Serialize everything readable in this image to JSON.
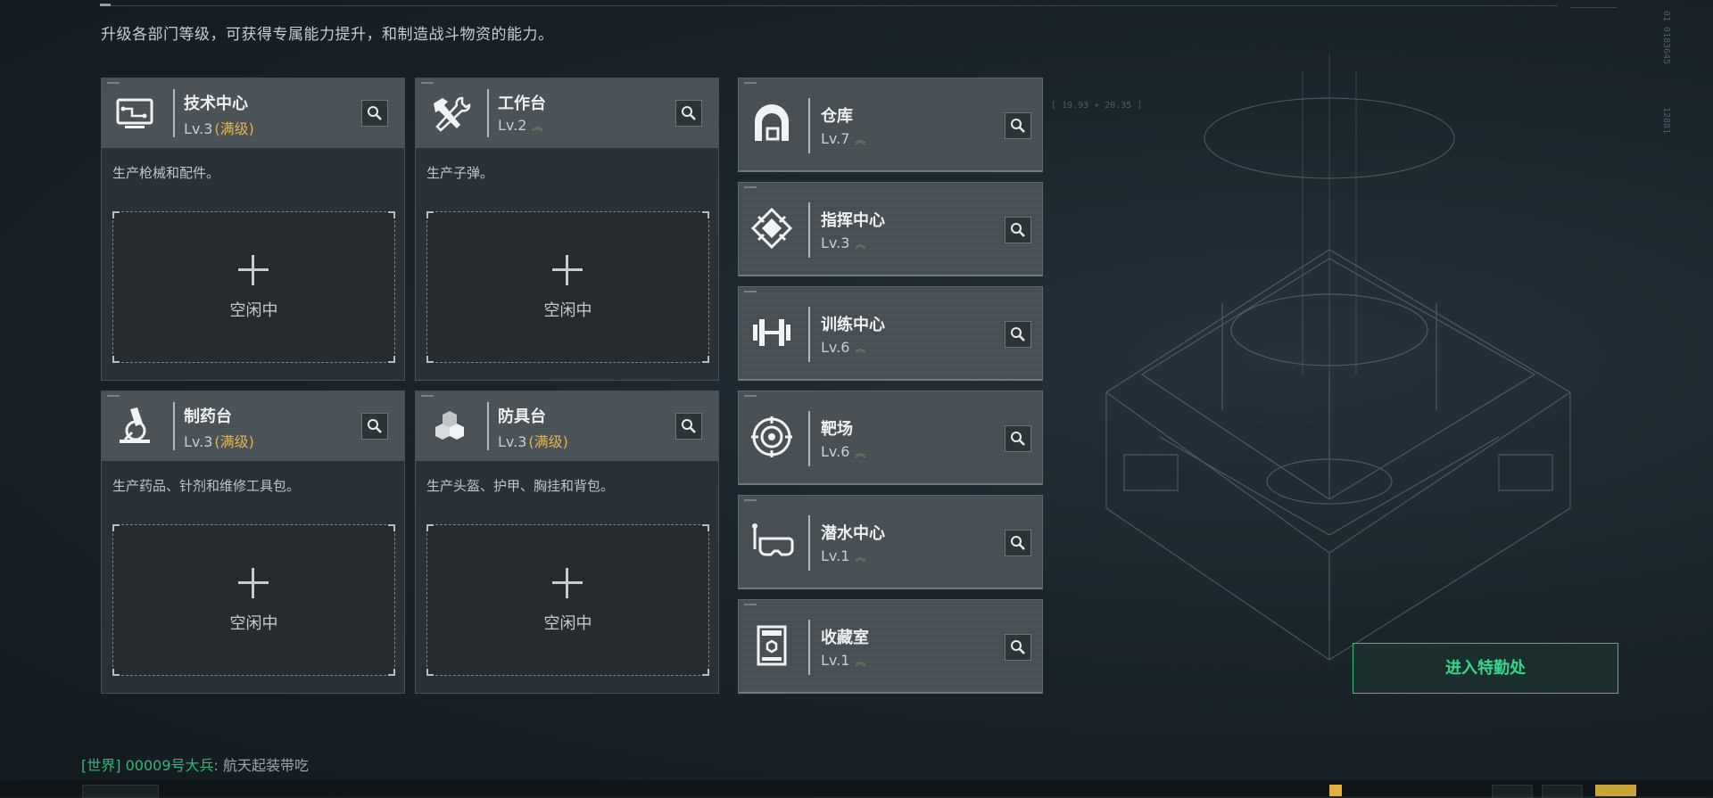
{
  "intro_text": "升级各部门等级，可获得专属能力提升，和制造战斗物资的能力。",
  "production": [
    {
      "name": "技术中心",
      "level": "Lv.3",
      "max_label": "(满级)",
      "maxed": true,
      "icon": "monitor-circuit-icon",
      "desc": "生产枪械和配件。",
      "slot_status": "空闲中"
    },
    {
      "name": "工作台",
      "level": "Lv.2",
      "max_label": "",
      "maxed": false,
      "icon": "hammer-wrench-icon",
      "desc": "生产子弹。",
      "slot_status": "空闲中"
    },
    {
      "name": "制药台",
      "level": "Lv.3",
      "max_label": "(满级)",
      "maxed": true,
      "icon": "microscope-icon",
      "desc": "生产药品、针剂和维修工具包。",
      "slot_status": "空闲中"
    },
    {
      "name": "防具台",
      "level": "Lv.3",
      "max_label": "(满级)",
      "maxed": true,
      "icon": "armor-boxes-icon",
      "desc": "生产头盔、护甲、胸挂和背包。",
      "slot_status": "空闲中"
    }
  ],
  "facilities": [
    {
      "name": "仓库",
      "level": "Lv.7",
      "icon": "warehouse-icon"
    },
    {
      "name": "指挥中心",
      "level": "Lv.3",
      "icon": "command-emblem-icon"
    },
    {
      "name": "训练中心",
      "level": "Lv.6",
      "icon": "dumbbell-icon"
    },
    {
      "name": "靶场",
      "level": "Lv.6",
      "icon": "target-icon"
    },
    {
      "name": "潜水中心",
      "level": "Lv.1",
      "icon": "diving-mask-icon"
    },
    {
      "name": "收藏室",
      "level": "Lv.1",
      "icon": "display-case-icon"
    }
  ],
  "enter_button": "进入特勤处",
  "chat": {
    "channel": "[世界]",
    "user": "00009号大兵",
    "message": "航天起装带吃"
  },
  "hud": {
    "coords": "[ 19.93 + 20.35 ]",
    "serial_top": "01 0183645",
    "serial_mid": "12881"
  },
  "colors": {
    "accent_green": "#36d78a",
    "maxed_gold": "#e0b450",
    "level_chevron": "#7f8f5a"
  }
}
